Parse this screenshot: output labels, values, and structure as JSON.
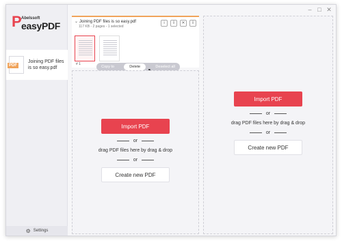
{
  "window": {
    "controls": [
      "–",
      "□",
      "✕"
    ]
  },
  "sidebar": {
    "logo": {
      "mark": "P",
      "brand_small": "Abelssoft",
      "brand_big": "easyPDF"
    },
    "doc_item": {
      "badge": "PDF",
      "label_line1": "Joining PDF files",
      "label_line2": "is so easy.pdf"
    },
    "settings_label": "Settings"
  },
  "document": {
    "title": "Joining PDF files is so easy.pdf",
    "meta": "117 KB - 2 pages - 1 selected",
    "tools": [
      "i",
      "⇩",
      "✕",
      "⇩"
    ],
    "pages": [
      {
        "num": "# 1",
        "selected": true
      },
      {
        "num": "",
        "selected": false
      }
    ],
    "actions": {
      "copy_to": "Copy to",
      "delete": "Delete",
      "deselect_all": "Deselect all"
    }
  },
  "drop_left": {
    "import_label": "Import PDF",
    "or1": "or",
    "drag_text": "drag PDF files here by drag & drop",
    "or2": "or",
    "create_label": "Create new PDF"
  },
  "drop_right": {
    "import_label": "Import PDF",
    "or1": "or",
    "drag_text": "drag PDF files here by drag & drop",
    "or2": "or",
    "create_label": "Create new PDF"
  },
  "colors": {
    "accent": "#e8434f",
    "badge": "#f0a35a"
  }
}
